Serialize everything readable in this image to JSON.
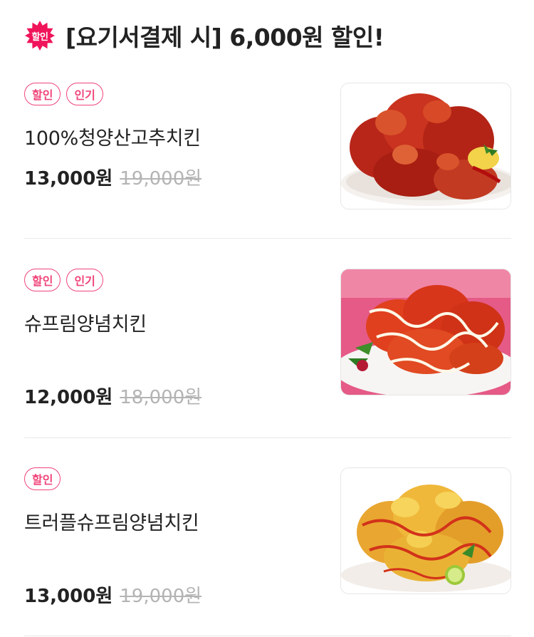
{
  "header": {
    "badge_label": "할인",
    "title": "[요기서결제 시] 6,000원 할인!"
  },
  "items": [
    {
      "tags": [
        "할인",
        "인기"
      ],
      "name": "100%청양산고추치킨",
      "price": "13,000원",
      "original_price": "19,000원",
      "image": "spicy-red-chicken-image"
    },
    {
      "tags": [
        "할인",
        "인기"
      ],
      "name": "슈프림양념치킨",
      "price": "12,000원",
      "original_price": "18,000원",
      "image": "sauce-mayo-chicken-image"
    },
    {
      "tags": [
        "할인"
      ],
      "name": "트러플슈프림양념치킨",
      "price": "13,000원",
      "original_price": "19,000원",
      "image": "truffle-cheese-chicken-image"
    }
  ],
  "colors": {
    "accent": "#f0457a",
    "text": "#222222",
    "muted": "#b4b4b4"
  }
}
